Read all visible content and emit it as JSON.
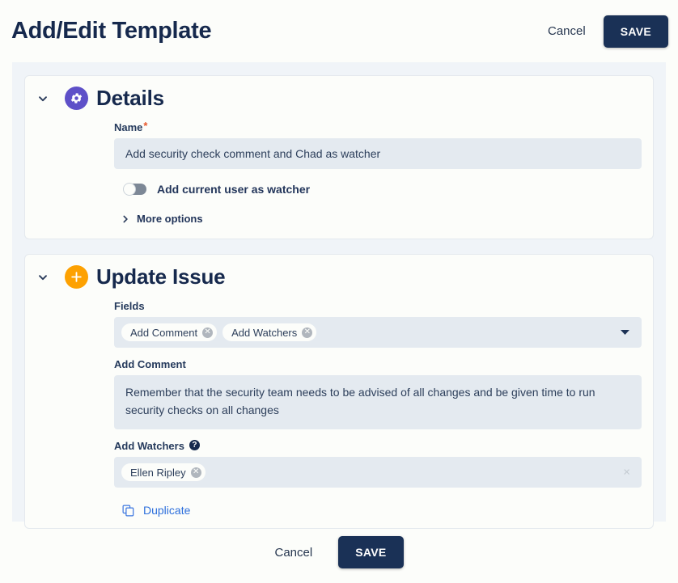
{
  "header": {
    "title": "Add/Edit Template",
    "cancel_label": "Cancel",
    "save_label": "SAVE"
  },
  "sections": [
    {
      "id": "details",
      "title": "Details",
      "icon": "gear-icon",
      "icon_color": "#5e50c8",
      "collapse_icon": "chevron-down-icon",
      "name_label": "Name",
      "name_required": "*",
      "name_value": "Add security check comment and Chad as watcher",
      "toggle_label": "Add current user as watcher",
      "toggle_state": "off",
      "more_options_label": "More options",
      "more_options_icon": "chevron-right-icon"
    },
    {
      "id": "update-issue",
      "title": "Update Issue",
      "icon": "plus-icon",
      "icon_color": "#fda101",
      "collapse_icon": "chevron-down-icon",
      "fields_label": "Fields",
      "fields_chips": [
        "Add Comment",
        "Add Watchers"
      ],
      "fields_caret_icon": "caret-down-icon",
      "comment_label": "Add Comment",
      "comment_value": "Remember that the security team needs to be advised of all changes and be given time to run security checks on all changes",
      "watchers_label": "Add Watchers",
      "watchers_help_icon": "?",
      "watchers_chips": [
        "Ellen Ripley"
      ],
      "watchers_clear_icon": "×",
      "duplicate_label": "Duplicate",
      "duplicate_icon": "copy-icon"
    }
  ],
  "footer": {
    "cancel_label": "Cancel",
    "save_label": "SAVE"
  }
}
